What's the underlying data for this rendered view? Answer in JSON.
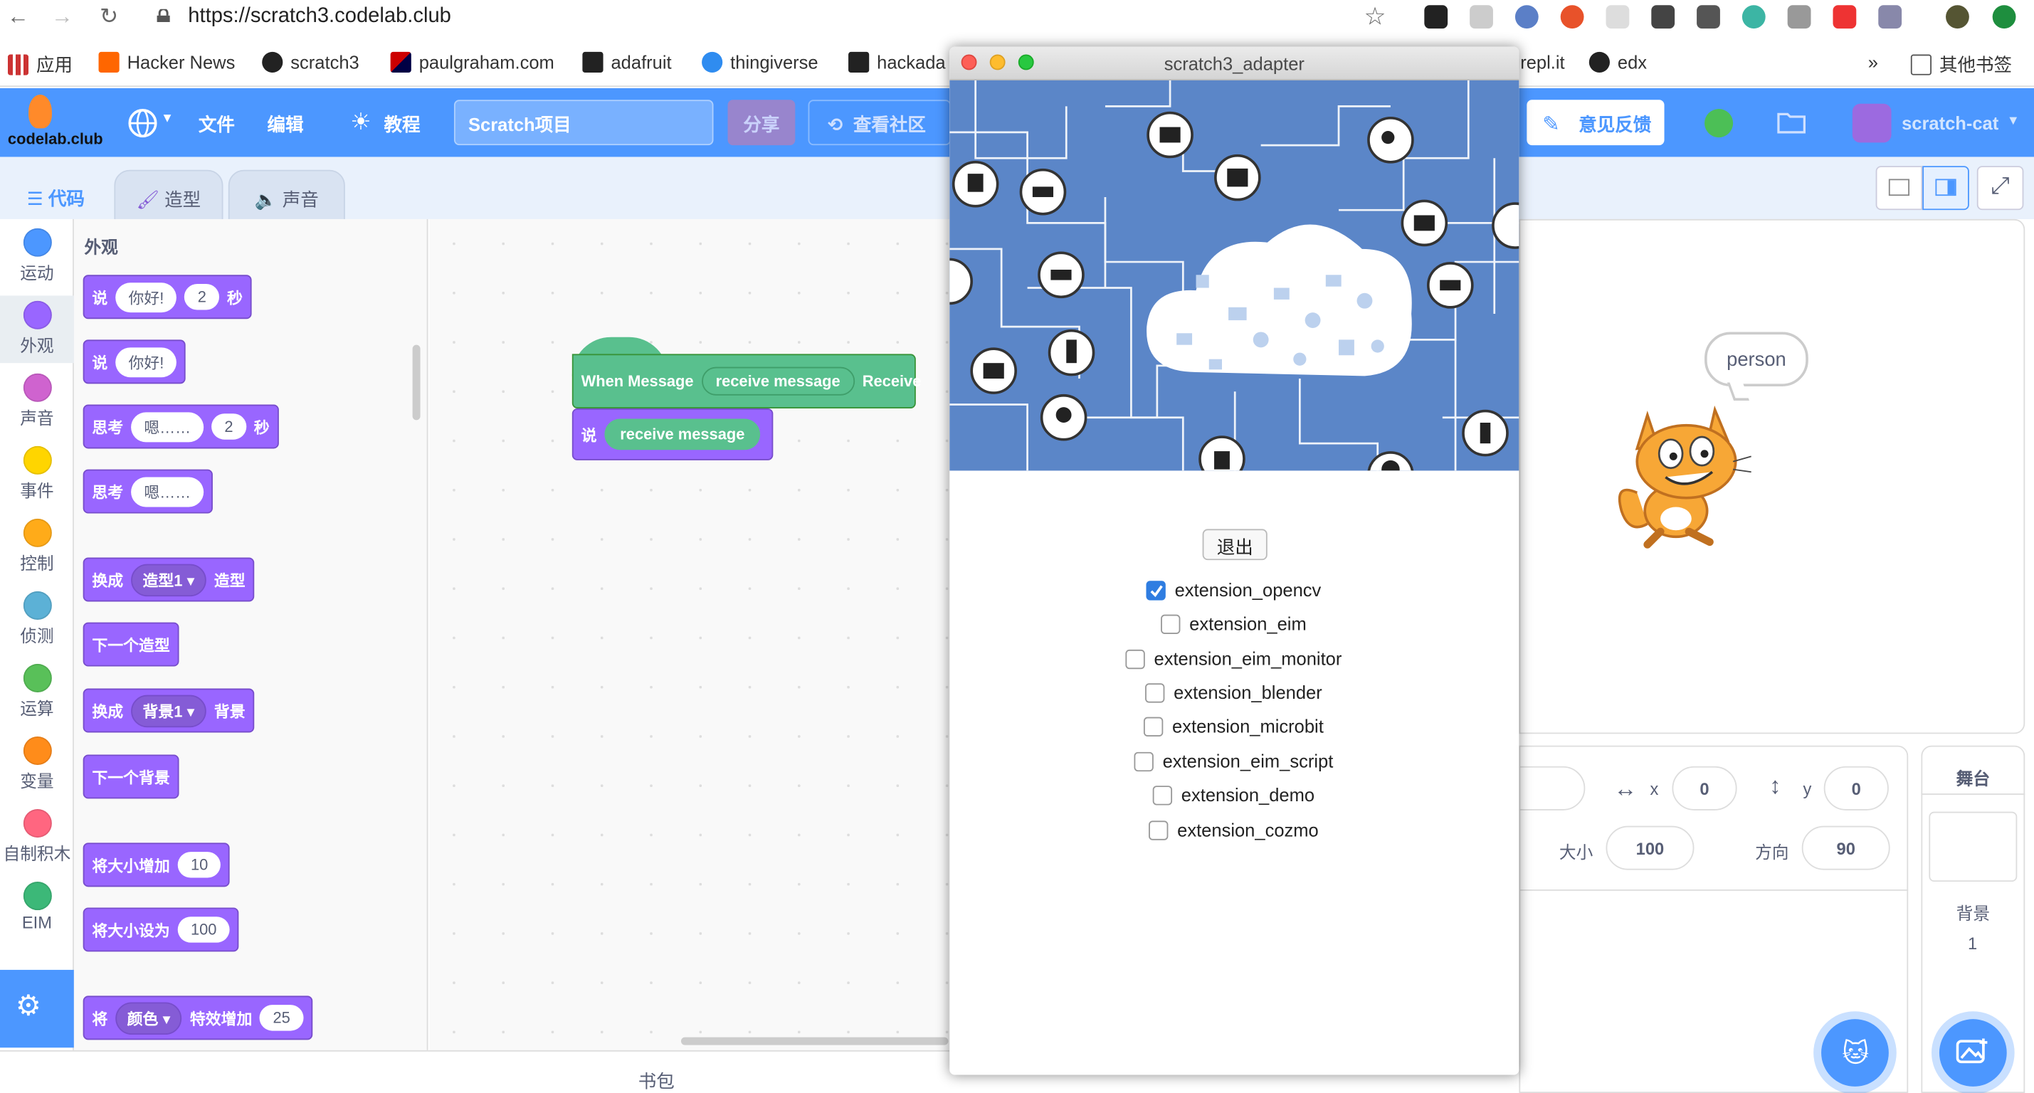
{
  "browser": {
    "url": "https://scratch3.codelab.club",
    "bookmarks": [
      "应用",
      "Hacker News",
      "scratch3",
      "paulgraham.com",
      "adafruit",
      "thingiverse",
      "hackada",
      "repl.it",
      "edx"
    ],
    "more": "»",
    "other_bookmarks": "其他书签"
  },
  "menubar": {
    "logo": "codelab.club",
    "file": "文件",
    "edit": "编辑",
    "tutorial": "教程",
    "project_title": "Scratch项目",
    "share": "分享",
    "community": "查看社区",
    "feedback": "意见反馈",
    "user": "scratch-cat"
  },
  "tabs": {
    "code": "代码",
    "costume": "造型",
    "sound": "声音"
  },
  "categories": [
    "运动",
    "外观",
    "声音",
    "事件",
    "控制",
    "侦测",
    "运算",
    "变量",
    "自制积木",
    "EIM"
  ],
  "category_colors": [
    "#4c97ff",
    "#9966ff",
    "#cf63cf",
    "#ffd500",
    "#ffab19",
    "#5cb1d6",
    "#59c059",
    "#ff8c1a",
    "#ff6680",
    "#3cb878"
  ],
  "palette": {
    "heading": "外观",
    "blocks": {
      "say_for": {
        "say": "说",
        "msg": "你好!",
        "secs": "2",
        "unit": "秒"
      },
      "say": {
        "say": "说",
        "msg": "你好!"
      },
      "think_for": {
        "think": "思考",
        "msg": "嗯……",
        "secs": "2",
        "unit": "秒"
      },
      "think": {
        "think": "思考",
        "msg": "嗯……"
      },
      "switch_costume": {
        "a": "换成",
        "val": "造型1",
        "b": "造型"
      },
      "next_costume": "下一个造型",
      "switch_backdrop": {
        "a": "换成",
        "val": "背景1",
        "b": "背景"
      },
      "next_backdrop": "下一个背景",
      "change_size": {
        "text": "将大小增加",
        "val": "10"
      },
      "set_size": {
        "text": "将大小设为",
        "val": "100"
      },
      "change_effect": {
        "a": "将",
        "val": "颜色",
        "b": "特效增加",
        "num": "25"
      }
    }
  },
  "workspace": {
    "hat": {
      "text": "When Message",
      "arg": "receive message",
      "tail": "Receive"
    },
    "say": {
      "text": "说",
      "arg": "receive message"
    },
    "backpack": "书包"
  },
  "popup": {
    "title": "scratch3_adapter",
    "exit": "退出",
    "extensions": [
      {
        "name": "extension_opencv",
        "checked": true
      },
      {
        "name": "extension_eim",
        "checked": false
      },
      {
        "name": "extension_eim_monitor",
        "checked": false
      },
      {
        "name": "extension_blender",
        "checked": false
      },
      {
        "name": "extension_microbit",
        "checked": false
      },
      {
        "name": "extension_eim_script",
        "checked": false
      },
      {
        "name": "extension_demo",
        "checked": false
      },
      {
        "name": "extension_cozmo",
        "checked": false
      }
    ]
  },
  "stage": {
    "speech": "person",
    "x_label": "x",
    "x": "0",
    "y_label": "y",
    "y": "0",
    "size_label": "大小",
    "size": "100",
    "direction_label": "方向",
    "direction": "90",
    "stage_label": "舞台",
    "backdrop_label": "背景",
    "backdrop_count": "1"
  }
}
